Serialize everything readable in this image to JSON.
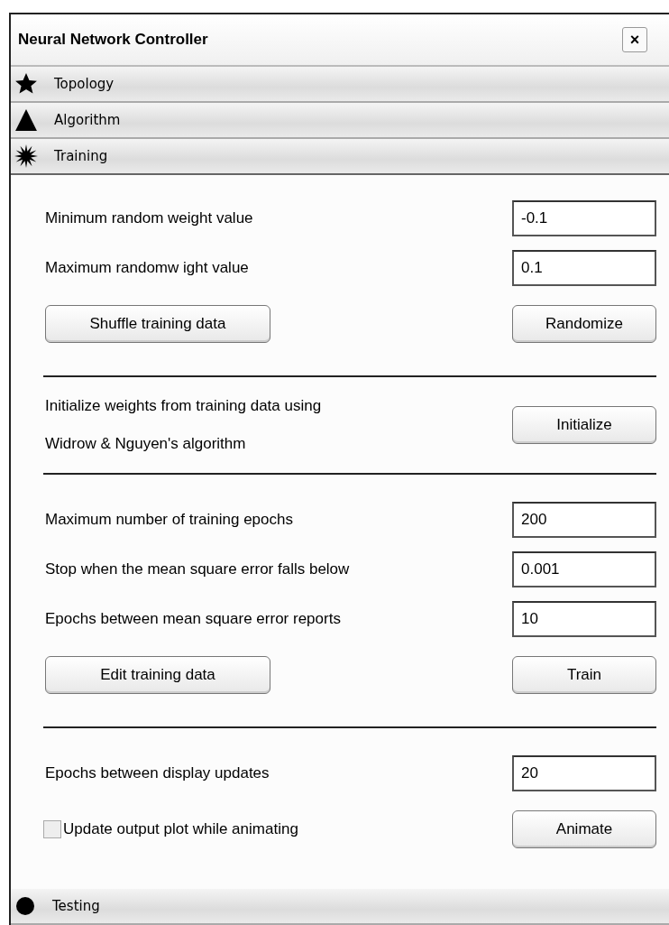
{
  "window": {
    "title": "Neural Network Controller",
    "close": "×"
  },
  "sections": [
    {
      "kind": "star",
      "title": "Topology",
      "expanded": false
    },
    {
      "kind": "triangle",
      "title": "Algorithm",
      "expanded": false
    },
    {
      "kind": "burst",
      "title": "Training",
      "expanded": true,
      "groups": [
        {
          "rows": [
            {
              "kind": "field",
              "label": "Minimum random weight value",
              "value": "-0.1"
            },
            {
              "kind": "field",
              "label": "Maximum randomw   ight value",
              "value": "0.1"
            },
            {
              "kind": "buttons",
              "left": "Shuffle training data",
              "right": "Randomize"
            }
          ]
        },
        {
          "rows": [
            {
              "kind": "text_button",
              "lines": [
                "Initialize weights from training data using",
                "Widrow & Nguyen's algorithm"
              ],
              "button": "Initialize"
            }
          ]
        },
        {
          "rows": [
            {
              "kind": "field",
              "label": "Maximum number of training epochs",
              "value": "200"
            },
            {
              "kind": "field",
              "label": "Stop when the mean square error falls below",
              "value": "0.001"
            },
            {
              "kind": "field",
              "label": "Epochs between mean square error reports",
              "value": "10"
            },
            {
              "kind": "buttons",
              "left": "Edit training data",
              "right": "Train"
            }
          ]
        },
        {
          "rows": [
            {
              "kind": "field",
              "label": "Epochs between display updates",
              "value": "20"
            },
            {
              "kind": "checkbox_button",
              "label": "Update output plot while animating",
              "checked": false,
              "button": "Animate"
            }
          ]
        }
      ]
    },
    {
      "kind": "circle",
      "title": "Testing",
      "expanded": false
    }
  ]
}
